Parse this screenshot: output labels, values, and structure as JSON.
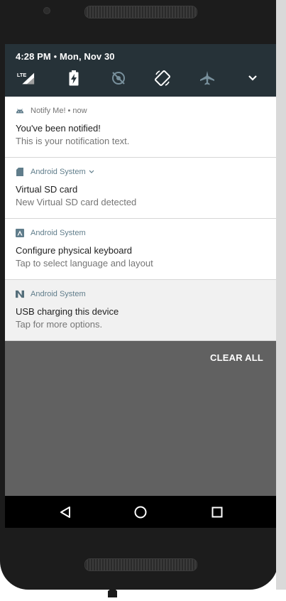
{
  "status": {
    "time": "4:28 PM",
    "separator": "•",
    "date": "Mon, Nov 30",
    "network_label": "LTE"
  },
  "quick_settings": {
    "icons": [
      "signal-lte-icon",
      "battery-charging-icon",
      "location-off-icon",
      "auto-rotate-icon",
      "airplane-mode-icon",
      "expand-chevron-icon"
    ]
  },
  "notifications": [
    {
      "app": "Notify Me!",
      "time": "now",
      "title": "You've been notified!",
      "text": "This is your notification text.",
      "icon": "android-icon"
    },
    {
      "app": "Android System",
      "title": "Virtual SD card",
      "text": "New Virtual SD card detected",
      "icon": "sd-card-icon",
      "expand_icon": "chevron-down-icon"
    },
    {
      "app": "Android System",
      "title": "Configure physical keyboard",
      "text": "Tap to select language and layout",
      "icon": "keyboard-icon"
    },
    {
      "app": "Android System",
      "title": "USB charging this device",
      "text": "Tap for more options.",
      "icon": "usb-icon"
    }
  ],
  "clear_all_label": "CLEAR ALL",
  "navbar": {
    "icons": [
      "back-icon",
      "home-icon",
      "recents-icon"
    ]
  },
  "colors": {
    "qs_background": "#263238",
    "app_name": "#607d8b",
    "shade_background": "#616161",
    "navbar": "#000000"
  }
}
